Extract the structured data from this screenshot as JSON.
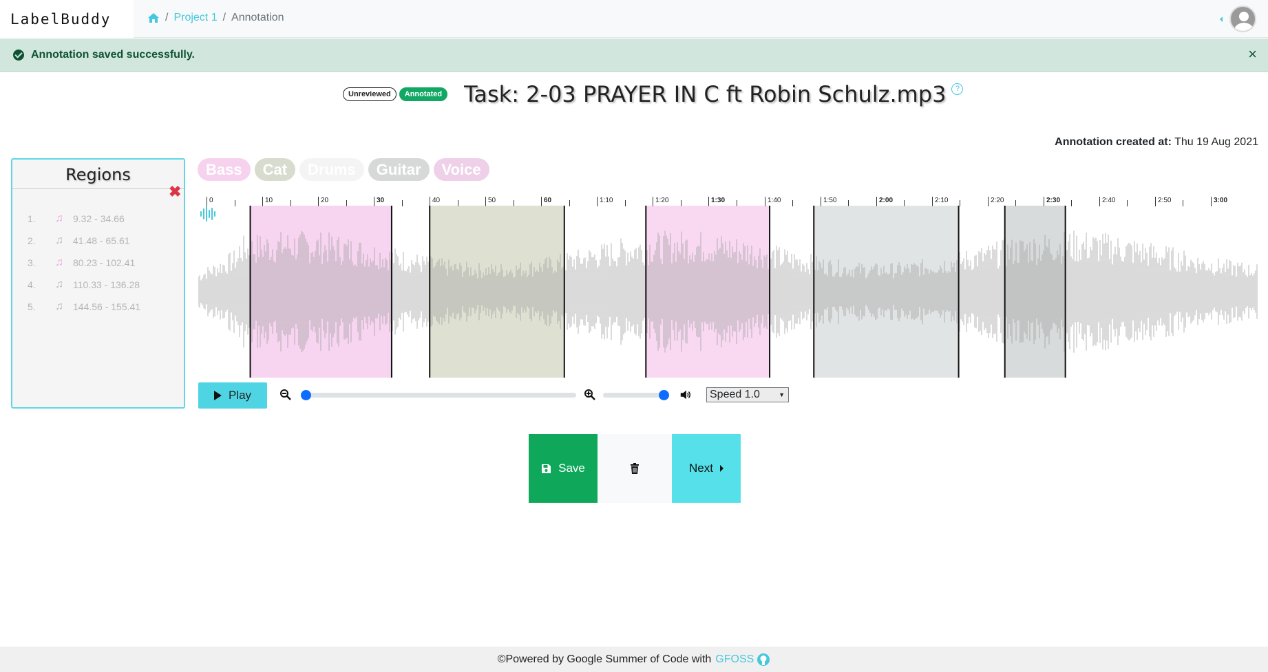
{
  "brand": {
    "left": "Label",
    "right": "Buddy"
  },
  "breadcrumb": {
    "project": "Project 1",
    "current": "Annotation",
    "sep": "/"
  },
  "alert": {
    "message": "Annotation saved successfully.",
    "close": "×"
  },
  "task": {
    "badges": [
      "Unreviewed",
      "Annotated"
    ],
    "title": "Task: 2-03 PRAYER IN C ft Robin Schulz.mp3",
    "help": "?"
  },
  "created": {
    "label": "Annotation created at:",
    "value": "Thu 19 Aug 2021"
  },
  "regions_panel": {
    "title": "Regions",
    "clear": "✖",
    "items": [
      {
        "num": "1.",
        "range": "9.32 - 34.66",
        "color": "#f0a6e0"
      },
      {
        "num": "2.",
        "range": "41.48 - 65.61",
        "color": "#bdbdbd"
      },
      {
        "num": "3.",
        "range": "80.23 - 102.41",
        "color": "#f0a6e0"
      },
      {
        "num": "4.",
        "range": "110.33 - 136.28",
        "color": "#bdbdbd"
      },
      {
        "num": "5.",
        "range": "144.56 - 155.41",
        "color": "#bdbdbd"
      }
    ]
  },
  "tags": [
    {
      "label": "Bass",
      "color": "#f6d2ee"
    },
    {
      "label": "Cat",
      "color": "#d8dccf"
    },
    {
      "label": "Drums",
      "color": "#f4f4f4"
    },
    {
      "label": "Guitar",
      "color": "#d7d9d9"
    },
    {
      "label": "Voice",
      "color": "#efd0e9"
    }
  ],
  "timeline": {
    "duration": 190,
    "labels": [
      "0",
      "10",
      "20",
      "30",
      "40",
      "50",
      "60",
      "1:10",
      "1:20",
      "1:30",
      "1:40",
      "1:50",
      "2:00",
      "2:10",
      "2:20",
      "2:30",
      "2:40",
      "2:50",
      "3:00"
    ],
    "bold": [
      "30",
      "60",
      "1:30",
      "2:00",
      "2:30",
      "3:00"
    ]
  },
  "regions_overlay": [
    {
      "start": 9.32,
      "end": 34.66,
      "color": "rgba(240,170,225,0.5)"
    },
    {
      "start": 41.48,
      "end": 65.61,
      "color": "rgba(200,205,180,0.6)"
    },
    {
      "start": 80.23,
      "end": 102.41,
      "color": "rgba(240,170,225,0.45)"
    },
    {
      "start": 110.33,
      "end": 136.28,
      "color": "rgba(200,205,205,0.55)"
    },
    {
      "start": 144.56,
      "end": 155.41,
      "color": "rgba(190,195,195,0.6)"
    }
  ],
  "controls": {
    "play": "Play",
    "speed": "Speed 1.0",
    "zoom_level": 0,
    "volume_level": 1
  },
  "actions": {
    "save": "Save",
    "next": "Next"
  },
  "footer": {
    "text": "©Powered by Google Summer of Code with",
    "link": "GFOSS"
  }
}
